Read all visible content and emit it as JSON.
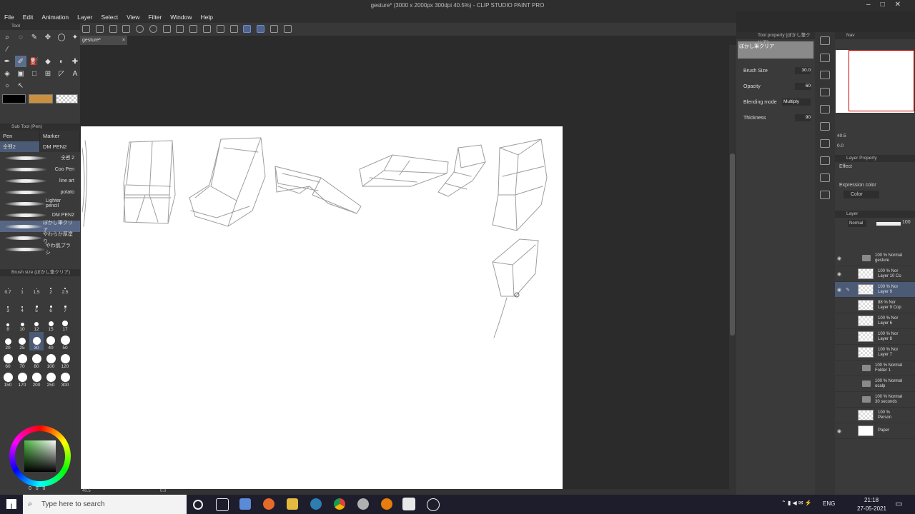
{
  "window": {
    "title": "gesture* (3000 x 2000px 300dpi 40.5%)  - CLIP STUDIO PAINT PRO",
    "controls": [
      "–",
      "□",
      "✕"
    ]
  },
  "menu": [
    "File",
    "Edit",
    "Animation",
    "Layer",
    "Select",
    "View",
    "Filter",
    "Window",
    "Help"
  ],
  "document_tab": "gesture*",
  "tool_palette": {
    "title": "Tool",
    "tools": [
      "select-lasso",
      "marquee",
      "magic-wand",
      "move",
      "lasso",
      "sparkle",
      "eyedropper",
      "",
      "",
      "",
      "",
      "",
      "pen",
      "pencil",
      "brush-airbrush",
      "eraser",
      "blend",
      "decorate",
      "fill",
      "gradient",
      "figure",
      "frame",
      "ruler",
      "text",
      "balloon",
      "correct"
    ]
  },
  "sub_tool": {
    "title": "Sub Tool (Pen)",
    "tabs": [
      "Pen",
      "Marker"
    ],
    "groups": [
      "숫펜2",
      "DM PEN2"
    ],
    "brushes": [
      {
        "name": "숫펜 2",
        "selected": false
      },
      {
        "name": "Coo Pen",
        "selected": false
      },
      {
        "name": "line art",
        "selected": false
      },
      {
        "name": "potato",
        "selected": false
      },
      {
        "name": "Lighter pencil",
        "selected": false
      },
      {
        "name": "DM PEN2",
        "selected": false
      },
      {
        "name": "ぼかし筆クリア",
        "selected": true
      },
      {
        "name": "やわらか厚塗り",
        "selected": false
      },
      {
        "name": "やわ肌ブラシ",
        "selected": false
      }
    ]
  },
  "brush_size_palette": {
    "title": "Brush size (ぼかし筆クリア)",
    "sizes": [
      "0.7",
      "1",
      "1.5",
      "2",
      "2.5",
      "3",
      "4",
      "5",
      "6",
      "7",
      "8",
      "10",
      "12",
      "15",
      "17",
      "20",
      "25",
      "30",
      "40",
      "50",
      "60",
      "70",
      "80",
      "100",
      "120",
      "150",
      "170",
      "200",
      "250",
      "300"
    ],
    "selected": "30"
  },
  "color_values": [
    "0",
    "0",
    "0"
  ],
  "tool_property": {
    "title": "Tool property [ぼかし筆クリア]",
    "brush_name": "ぼかし筆クリア",
    "brush_size_label": "Brush Size",
    "brush_size": "30.0",
    "opacity_label": "Opacity",
    "opacity": "60",
    "blending_label": "Blending mode",
    "blending": "Multiply",
    "thickness_label": "Thickness",
    "thickness": "90"
  },
  "navigator": {
    "title": "Nav",
    "zoom": "40.5",
    "rotate": "0.0"
  },
  "layer_property": {
    "title": "Layer Property",
    "effect_label": "Effect",
    "expression_label": "Expression color",
    "expression_value": "Color"
  },
  "layer_panel": {
    "title": "Layer",
    "blend": "Normal",
    "opacity": "100",
    "layers": [
      {
        "line1": "100 % Normal",
        "line2": "gesture",
        "type": "folder",
        "visible": true,
        "selected": false
      },
      {
        "line1": "100 % Nor",
        "line2": "Layer 10 Co",
        "type": "layer",
        "visible": true,
        "selected": false
      },
      {
        "line1": "100 % Nor",
        "line2": "Layer 9",
        "type": "layer",
        "visible": true,
        "selected": true
      },
      {
        "line1": "88 % Nor",
        "line2": "Layer 9 Cop",
        "type": "layer",
        "visible": false,
        "selected": false
      },
      {
        "line1": "100 % Nor",
        "line2": "Layer 6",
        "type": "layer",
        "visible": false,
        "selected": false
      },
      {
        "line1": "100 % Nor",
        "line2": "Layer 8",
        "type": "layer",
        "visible": false,
        "selected": false
      },
      {
        "line1": "100 % Nor",
        "line2": "Layer 7",
        "type": "layer",
        "visible": false,
        "selected": false
      },
      {
        "line1": "100 % Normal",
        "line2": "Folder 1",
        "type": "folder",
        "visible": false,
        "selected": false
      },
      {
        "line1": "100 % Normal",
        "line2": "ocalp",
        "type": "folder",
        "visible": false,
        "selected": false
      },
      {
        "line1": "100 % Normal",
        "line2": "30 seconds",
        "type": "folder",
        "visible": false,
        "selected": false
      },
      {
        "line1": "100 %",
        "line2": "Person",
        "type": "layer",
        "visible": false,
        "selected": false
      },
      {
        "line1": "",
        "line2": "Paper",
        "type": "paper",
        "visible": true,
        "selected": false
      }
    ]
  },
  "status": {
    "zoom": "40.5",
    "angle": "0.0"
  },
  "taskbar": {
    "search_placeholder": "Type here to search",
    "lang": "ENG",
    "time": "21:18",
    "date": "27-05-2021"
  }
}
